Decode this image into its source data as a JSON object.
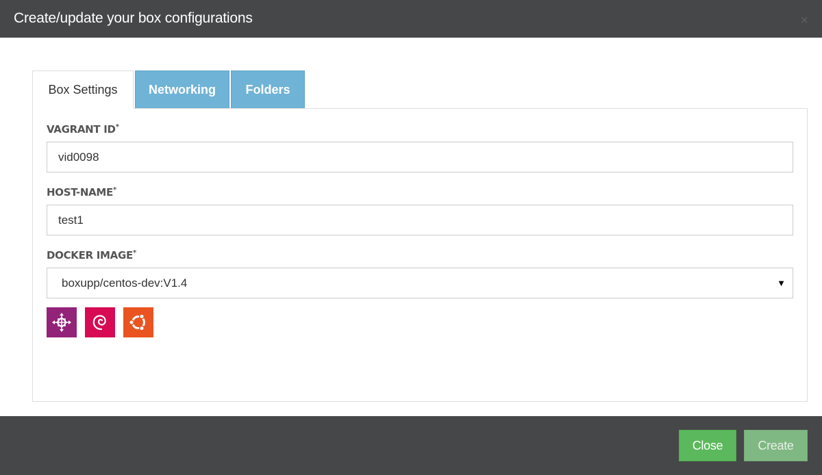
{
  "dialog": {
    "title": "Create/update your box configurations",
    "close_glyph": "×"
  },
  "tabs": [
    {
      "label": "Box Settings",
      "active": true
    },
    {
      "label": "Networking",
      "active": false
    },
    {
      "label": "Folders",
      "active": false
    }
  ],
  "fields": {
    "vagrant_id": {
      "label": "VAGRANT ID",
      "required_mark": "*",
      "value": "vid0098"
    },
    "host_name": {
      "label": "HOST-NAME",
      "required_mark": "*",
      "value": "test1"
    },
    "docker_image": {
      "label": "DOCKER IMAGE",
      "required_mark": "*",
      "selected": "boxupp/centos-dev:V1.4",
      "arrow": "▼"
    }
  },
  "os_icons": [
    {
      "name": "centos-icon",
      "color": "#932279"
    },
    {
      "name": "debian-icon",
      "color": "#d70a53"
    },
    {
      "name": "ubuntu-icon",
      "color": "#e95420"
    }
  ],
  "footer": {
    "close_label": "Close",
    "create_label": "Create"
  },
  "colors": {
    "header_bg": "#464749",
    "tab_inactive": "#6fb3d6",
    "close_button": "#5cb85c",
    "create_button": "#7fb883"
  }
}
